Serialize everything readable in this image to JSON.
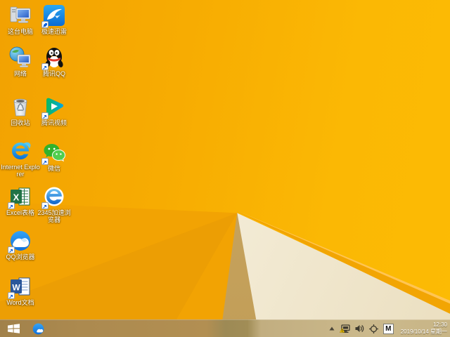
{
  "desktop": {
    "icons": [
      {
        "name": "this-pc-icon",
        "label": "这台电脑"
      },
      {
        "name": "xunlei-icon",
        "label": "极速迅雷"
      },
      {
        "name": "network-icon",
        "label": "网络"
      },
      {
        "name": "tencent-qq-icon",
        "label": "腾讯QQ"
      },
      {
        "name": "recycle-bin-icon",
        "label": "回收站"
      },
      {
        "name": "tencent-video-icon",
        "label": "腾讯视频"
      },
      {
        "name": "internet-explorer-icon",
        "label": "Internet Explorer"
      },
      {
        "name": "wechat-icon",
        "label": "微信"
      },
      {
        "name": "excel-icon",
        "label": "Excel表格"
      },
      {
        "name": "browser-2345-icon",
        "label": "2345加速浏览器"
      },
      {
        "name": "qq-browser-icon",
        "label": "QQ浏览器"
      },
      {
        "name": "word-icon",
        "label": "Word文档"
      }
    ]
  },
  "taskbar": {
    "start_icon": "windows-start-icon",
    "pinned": [
      {
        "name": "qq-browser-taskbar-icon"
      }
    ],
    "tray": {
      "icons": [
        "hidden-icons-chevron-icon",
        "network-warning-icon",
        "volume-icon",
        "crosshair-icon",
        "ime-indicator"
      ],
      "ime_indicator": "M",
      "time": "12:30",
      "date": "2019/10/14 星期一"
    }
  },
  "colors": {
    "wallpaper_orange": "#F7AC02",
    "wallpaper_bright": "#FCBB04",
    "facet_shadow": "#EC9E04",
    "facet_tan": "#C6A25D",
    "facet_cream": "#F6EFDC",
    "edge_amber": "#F2A503",
    "taskbar_left": "#AC8A4F",
    "taskbar_right": "#C8B586",
    "icon_label_text": "#FFFFFF"
  }
}
